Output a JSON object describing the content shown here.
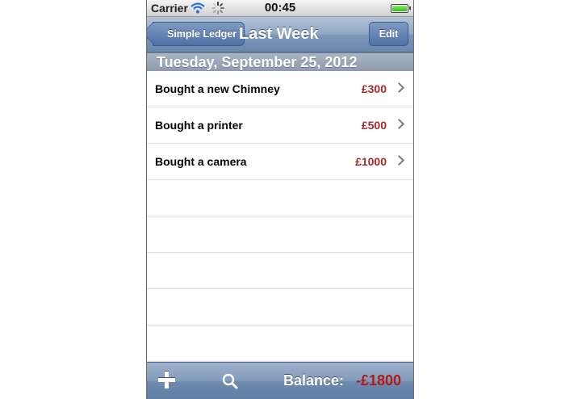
{
  "status_bar": {
    "carrier": "Carrier",
    "time": "00:45"
  },
  "nav": {
    "back_label": "Simple Ledger",
    "title": "Last Week",
    "edit_label": "Edit"
  },
  "section": {
    "date": "Tuesday, September 25, 2012"
  },
  "entries": [
    {
      "description": "Bought a new Chimney",
      "amount": "£300"
    },
    {
      "description": "Bought a printer",
      "amount": "£500"
    },
    {
      "description": "Bought a camera",
      "amount": "£1000"
    }
  ],
  "toolbar": {
    "balance_label": "Balance:",
    "balance_value": "-£1800"
  },
  "colors": {
    "amount": "#a52a2a",
    "balance": "#b01a1a",
    "nav_bar": "#7d97b8"
  },
  "icons": [
    "wifi-icon",
    "activity-spinner-icon",
    "battery-icon",
    "chevron-right-icon",
    "plus-icon",
    "search-icon"
  ]
}
